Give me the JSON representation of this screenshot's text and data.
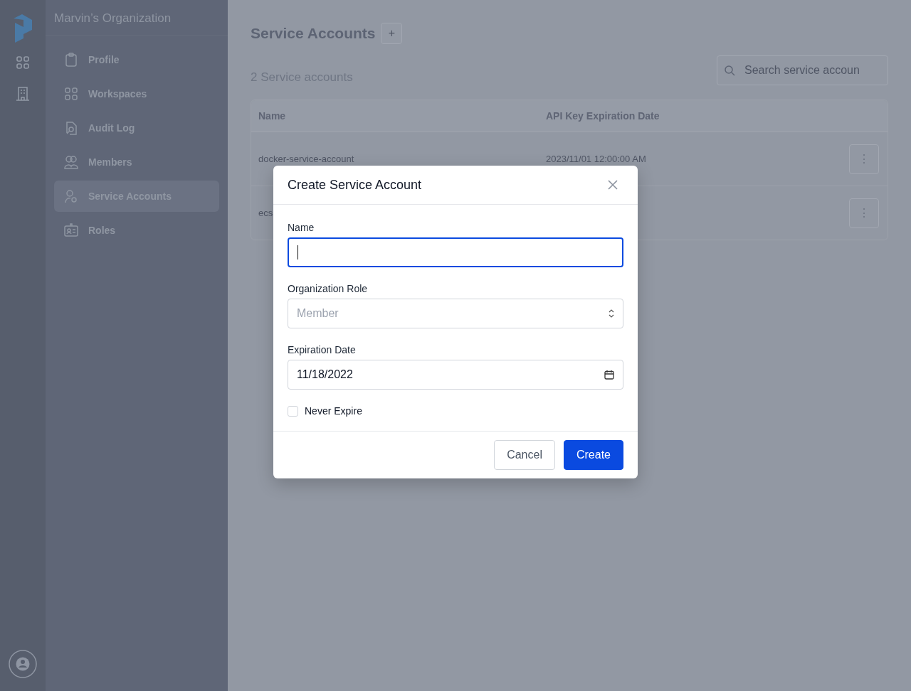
{
  "org_name": "Marvin’s Organization",
  "rail": {
    "items": [
      {
        "selected": false
      },
      {
        "selected": false
      }
    ]
  },
  "sidebar": {
    "items": [
      {
        "label": "Profile",
        "selected": false
      },
      {
        "label": "Workspaces",
        "selected": false
      },
      {
        "label": "Audit Log",
        "selected": false
      },
      {
        "label": "Members",
        "selected": false
      },
      {
        "label": "Service Accounts",
        "selected": true
      },
      {
        "label": "Roles",
        "selected": false
      }
    ]
  },
  "page": {
    "title": "Service Accounts",
    "add_button": "+",
    "count": "2 Service accounts",
    "search": {
      "placeholder": "Search service accoun"
    }
  },
  "table": {
    "columns": [
      "Name",
      "API Key Expiration Date"
    ],
    "rows": [
      {
        "name": "docker-service-account",
        "expiration": "2023/11/01 12:00:00 AM",
        "menu": "⋮"
      },
      {
        "name": "ecs",
        "menu": "⋮"
      }
    ]
  },
  "dialog": {
    "title": "Create Service Account",
    "name_field": {
      "label": "Name",
      "focused": true
    },
    "role_field": {
      "label": "Organization Role",
      "placeholder": "Member"
    },
    "date_field": {
      "label": "Expiration Date",
      "value": "11/18/2022"
    },
    "never_expire": {
      "label": "Never Expire",
      "checked": false
    },
    "buttons": [
      {
        "label": "Cancel",
        "kind": "secondary"
      },
      {
        "label": "Create",
        "kind": "primary"
      }
    ]
  }
}
